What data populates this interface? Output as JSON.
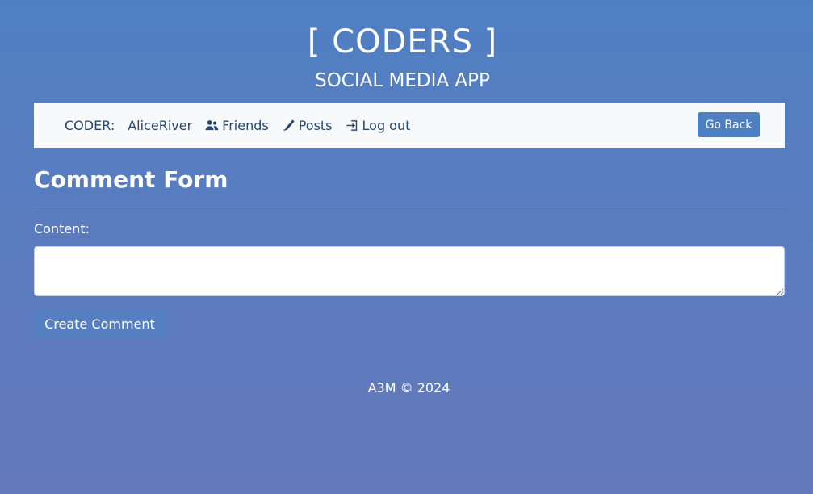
{
  "header": {
    "title": "[ CODERS ]",
    "subtitle": "SOCIAL MEDIA APP"
  },
  "nav": {
    "label": "CODER:",
    "username": "AliceRiver",
    "links": [
      {
        "label": "Friends",
        "icon": "users-icon"
      },
      {
        "label": "Posts",
        "icon": "pen-icon"
      },
      {
        "label": "Log out",
        "icon": "log-out-icon"
      }
    ],
    "go_back_label": "Go Back"
  },
  "form": {
    "title": "Comment Form",
    "content_label": "Content:",
    "content_value": "",
    "submit_label": "Create Comment"
  },
  "footer": {
    "text": "A3M © 2024"
  },
  "colors": {
    "background_top": "#4f7fc3",
    "background_bottom": "#6379bb",
    "navbar_background": "#f8f9fa",
    "nav_text": "#24476f",
    "button": "#4f7fc3"
  }
}
